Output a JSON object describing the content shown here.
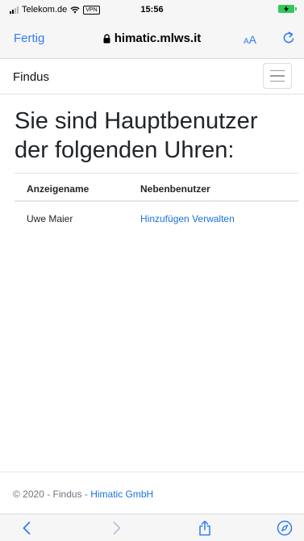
{
  "status_bar": {
    "carrier": "Telekom.de",
    "vpn_badge": "VPN",
    "time": "15:56"
  },
  "browser": {
    "done_label": "Fertig",
    "url": "himatic.mlws.it",
    "text_size_label_small": "A",
    "text_size_label_large": "A"
  },
  "navbar": {
    "brand": "Findus"
  },
  "main": {
    "heading": "Sie sind Hauptbenutzer der folgenden Uhren:",
    "table": {
      "headers": [
        "Anzeigename",
        "Nebenbenutzer"
      ],
      "rows": [
        {
          "name": "Uwe Maier",
          "actions": [
            "Hinzufügen",
            "Verwalten"
          ]
        }
      ]
    }
  },
  "footer": {
    "prefix": "© 2020 - Findus - ",
    "link": "Himatic GmbH"
  },
  "colors": {
    "link": "#1a73d9",
    "ios_accent": "#2e7cf6",
    "battery": "#34c759"
  },
  "icons": {
    "status": [
      "signal-icon",
      "wifi-icon",
      "battery-charging-icon"
    ],
    "browser": [
      "lock-icon",
      "reload-icon"
    ],
    "toolbar": [
      "back-icon",
      "forward-icon",
      "share-icon",
      "compass-icon"
    ]
  }
}
